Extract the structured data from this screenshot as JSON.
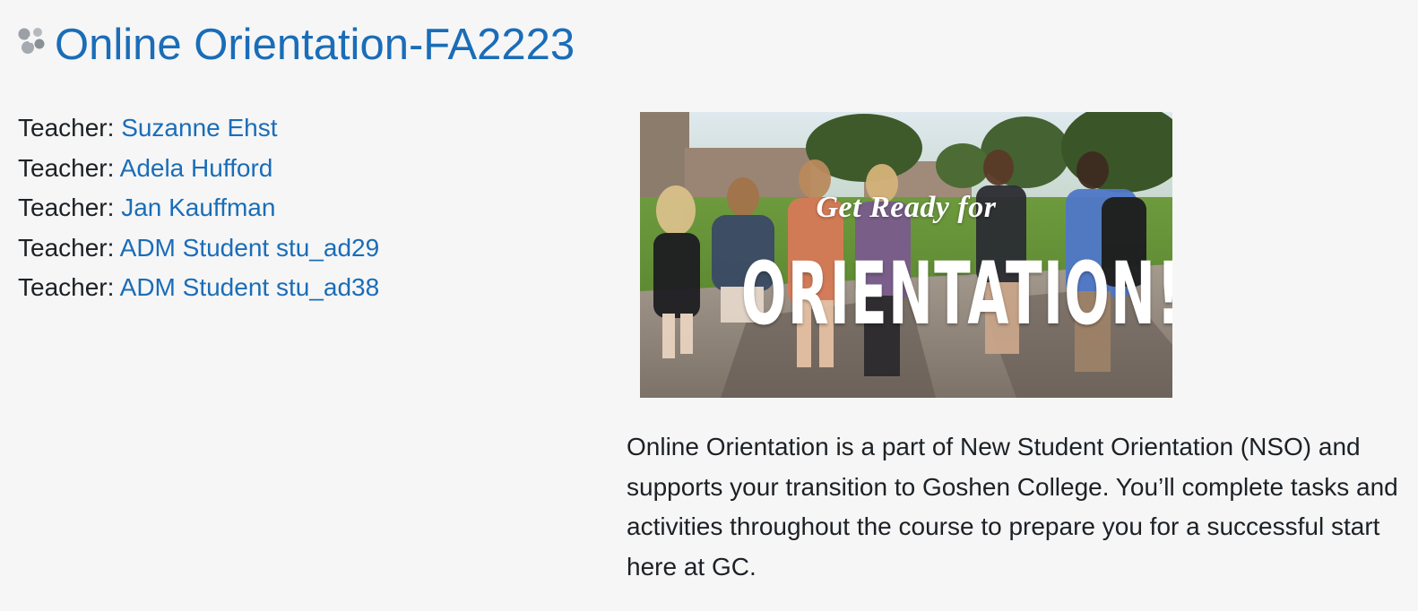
{
  "course": {
    "title": "Online Orientation-FA2223",
    "icon": "course-icon"
  },
  "teachers": [
    {
      "label": "Teacher:",
      "name": "Suzanne Ehst"
    },
    {
      "label": "Teacher:",
      "name": "Adela Hufford"
    },
    {
      "label": "Teacher:",
      "name": "Jan Kauffman"
    },
    {
      "label": "Teacher:",
      "name": "ADM Student stu_ad29"
    },
    {
      "label": "Teacher:",
      "name": "ADM Student stu_ad38"
    }
  ],
  "banner": {
    "tagline": "Get Ready for",
    "headline": "ORIENTATION!"
  },
  "summary": "Online Orientation is a part of New Student Orientation (NSO) and supports your transition to Goshen College. You’ll complete tasks and activities throughout the course to prepare you for a successful start here at GC.",
  "colors": {
    "link": "#1a6db8",
    "text": "#1d2125",
    "background": "#f6f6f6"
  }
}
